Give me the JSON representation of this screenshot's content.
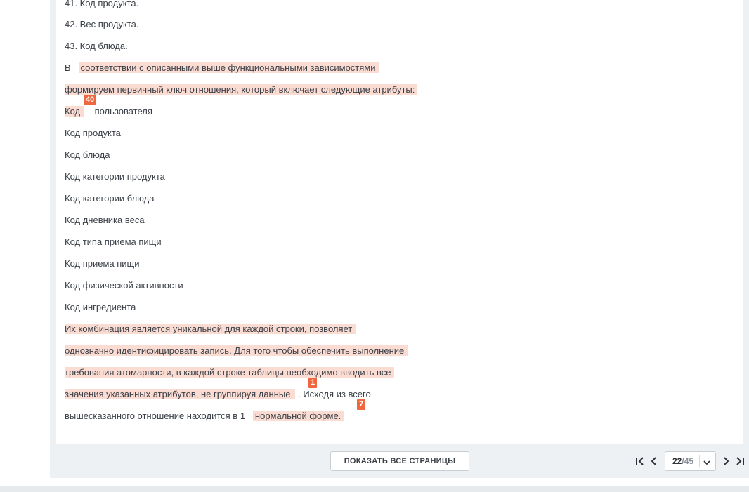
{
  "document": {
    "lines": [
      {
        "text": "41. Код продукта."
      },
      {
        "text": "42. Вес продукта."
      },
      {
        "text": "43. Код блюда."
      },
      {
        "prefix": "В",
        "highlight": "соответствии с описанными выше функциональными зависимостями"
      },
      {
        "highlight": "формируем первичный ключ отношения, который включает следующие атрибуты:"
      },
      {
        "highlight": "Код",
        "suffix": "пользователя"
      },
      {
        "text": "Код продукта"
      },
      {
        "text": "Код блюда"
      },
      {
        "text": "Код категории продукта"
      },
      {
        "text": "Код категории блюда"
      },
      {
        "text": "Код дневника веса"
      },
      {
        "text": "Код типа приема пищи"
      },
      {
        "text": "Код приема пищи"
      },
      {
        "text": "Код физической активности"
      },
      {
        "text": "Код ингредиента"
      },
      {
        "highlight": "Их комбинация является уникальной для каждой строки, позволяет"
      },
      {
        "highlight": "однозначно идентифицировать запись. Для того чтобы обеспечить выполнение"
      },
      {
        "highlight": "требования атомарности, в каждой строке таблицы необходимо вводить все"
      },
      {
        "highlight": "значения указанных атрибутов, не группируя данные",
        "suffix": ". Исходя из всего"
      },
      {
        "prefix": "вышесказанного отношение находится в 1",
        "highlight": "нормальной форме."
      }
    ],
    "badges": [
      "40",
      "1",
      "7"
    ]
  },
  "footer": {
    "show_all_label": "ПОКАЗАТЬ ВСЕ СТРАНИЦЫ",
    "current_page": "22",
    "separator": "/",
    "total_pages": "45"
  },
  "icons": {
    "first": "first-page-icon",
    "prev": "prev-page-icon",
    "next": "next-page-icon",
    "last": "last-page-icon",
    "dropdown": "chevron-down-icon"
  },
  "colors": {
    "highlight": "#fbdcd2",
    "badge": "#f0673f"
  }
}
